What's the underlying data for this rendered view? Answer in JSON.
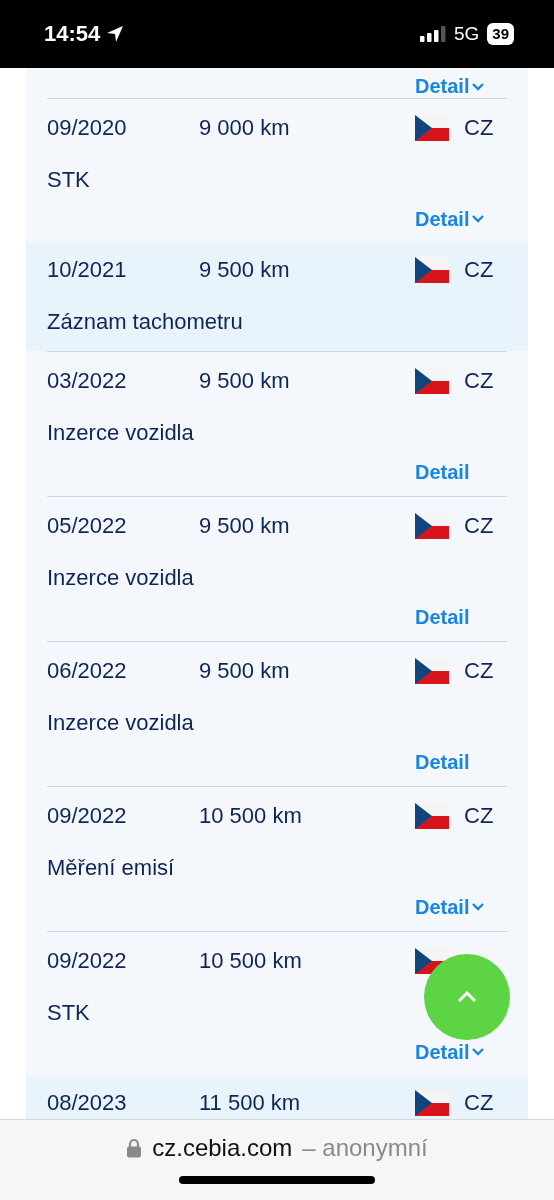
{
  "status_bar": {
    "time": "14:54",
    "network": "5G",
    "battery": "39"
  },
  "top_detail": {
    "label": "Detail",
    "chevron": true
  },
  "records": [
    {
      "date": "09/2020",
      "mileage": "9 000 km",
      "country": "CZ",
      "description": "STK",
      "highlighted": false,
      "detail": {
        "label": "Detail",
        "chevron": true
      }
    },
    {
      "date": "10/2021",
      "mileage": "9 500 km",
      "country": "CZ",
      "description": "Záznam tachometru",
      "highlighted": true
    },
    {
      "date": "03/2022",
      "mileage": "9 500 km",
      "country": "CZ",
      "description": "Inzerce vozidla",
      "highlighted": false,
      "detail": {
        "label": "Detail",
        "chevron": false
      }
    },
    {
      "date": "05/2022",
      "mileage": "9 500 km",
      "country": "CZ",
      "description": "Inzerce vozidla",
      "highlighted": false,
      "detail": {
        "label": "Detail",
        "chevron": false
      }
    },
    {
      "date": "06/2022",
      "mileage": "9 500 km",
      "country": "CZ",
      "description": "Inzerce vozidla",
      "highlighted": false,
      "detail": {
        "label": "Detail",
        "chevron": false
      }
    },
    {
      "date": "09/2022",
      "mileage": "10 500 km",
      "country": "CZ",
      "description": "Měření emisí",
      "highlighted": false,
      "detail": {
        "label": "Detail",
        "chevron": true
      }
    },
    {
      "date": "09/2022",
      "mileage": "10 500 km",
      "description": "STK",
      "highlighted": false,
      "detail": {
        "label": "Detail",
        "chevron": true
      }
    },
    {
      "date": "08/2023",
      "mileage": "11 500 km",
      "country": "CZ",
      "highlighted": true
    }
  ],
  "browser_bar": {
    "domain": "cz.cebia.com",
    "suffix": "– anonymní"
  }
}
